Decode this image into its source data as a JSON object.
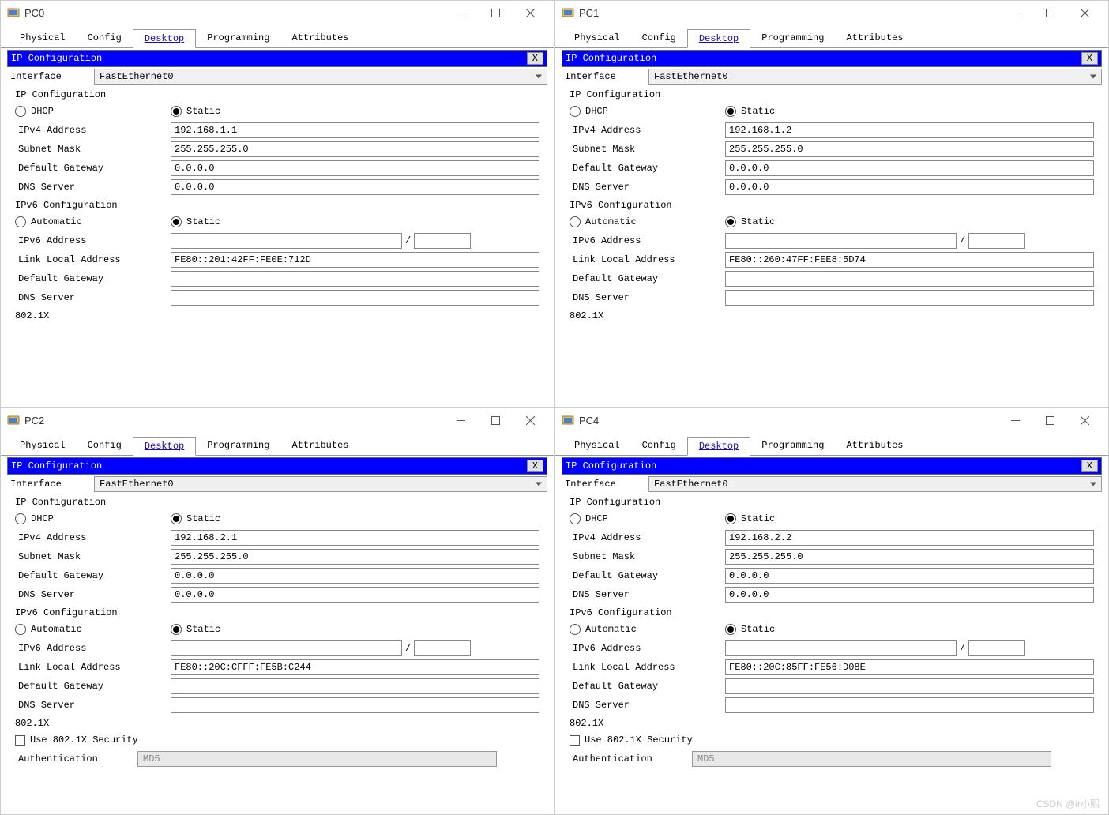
{
  "tabs": {
    "physical": "Physical",
    "config": "Config",
    "desktop": "Desktop",
    "programming": "Programming",
    "attributes": "Attributes"
  },
  "panel": {
    "title": "IP Configuration",
    "close": "X",
    "interface_label": "Interface",
    "interface_value": "FastEthernet0",
    "ip_config_section": "IP Configuration",
    "dhcp": "DHCP",
    "static": "Static",
    "ipv4_label": "IPv4 Address",
    "subnet_label": "Subnet Mask",
    "gateway_label": "Default Gateway",
    "dns_label": "DNS Server",
    "ipv6_section": "IPv6 Configuration",
    "automatic": "Automatic",
    "ipv6_label": "IPv6 Address",
    "link_local_label": "Link Local Address",
    "sec_8021x": "802.1X",
    "use_8021x": "Use 802.1X Security",
    "auth_label": "Authentication",
    "auth_value": "MD5"
  },
  "common": {
    "subnet": "255.255.255.0",
    "gateway": "0.0.0.0",
    "dns": "0.0.0.0"
  },
  "windows": [
    {
      "title": "PC0",
      "ipv4": "192.168.1.1",
      "link_local": "FE80::201:42FF:FE0E:712D",
      "show_8021x": false
    },
    {
      "title": "PC1",
      "ipv4": "192.168.1.2",
      "link_local": "FE80::260:47FF:FEE8:5D74",
      "show_8021x": false
    },
    {
      "title": "PC2",
      "ipv4": "192.168.2.1",
      "link_local": "FE80::20C:CFFF:FE5B:C244",
      "show_8021x": true
    },
    {
      "title": "PC4",
      "ipv4": "192.168.2.2",
      "link_local": "FE80::20C:85FF:FE56:D08E",
      "show_8021x": true
    }
  ],
  "watermark": "CSDN @ir小熙"
}
